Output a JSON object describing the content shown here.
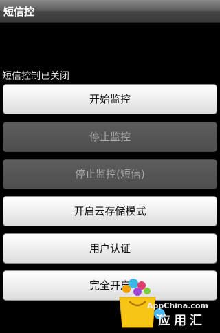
{
  "app": {
    "title": "短信控"
  },
  "status_text": "短信控制已关闭",
  "buttons": [
    {
      "label": "开始监控",
      "enabled": true
    },
    {
      "label": "停止监控",
      "enabled": false
    },
    {
      "label": "停止监控(短信)",
      "enabled": false
    },
    {
      "label": "开启云存储模式",
      "enabled": true
    },
    {
      "label": "用户认证",
      "enabled": true
    },
    {
      "label": "完全开启",
      "enabled": true
    }
  ],
  "watermark": {
    "site": "AppChina.com",
    "brand": "应用汇"
  }
}
